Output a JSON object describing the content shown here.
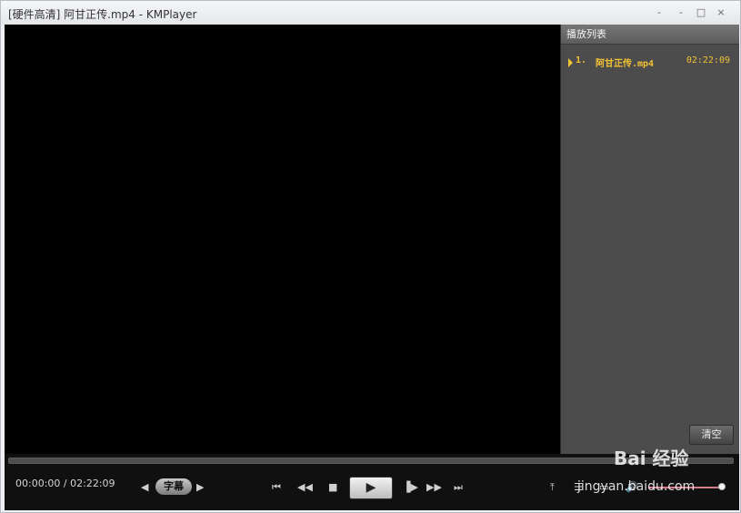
{
  "window": {
    "title": "[硬件高清] 阿甘正传.mp4 - KMPlayer",
    "buttons": [
      "-",
      "-",
      "□",
      "×"
    ]
  },
  "playlist": {
    "title": "播放列表",
    "items": [
      {
        "number": "1.",
        "name": "阿甘正传.mp4",
        "duration": "02:22:09",
        "active": true
      }
    ],
    "clear_label": "清空"
  },
  "player": {
    "time_current": "00:00:00",
    "time_separator": "/",
    "time_total": "02:22:09",
    "subtitle_label": "字幕",
    "seek_progress_percent": 0,
    "volume_percent": 95
  },
  "icons": {
    "subtitle_prev": "triangle-left-icon",
    "subtitle_next": "triangle-right-icon",
    "skip_prev": "skip-previous-icon",
    "rewind": "rewind-icon",
    "stop": "stop-icon",
    "play": "play-icon",
    "step": "step-forward-icon",
    "fast_forward": "fast-forward-icon",
    "skip_next": "skip-next-icon",
    "open": "open-file-icon",
    "playlist": "playlist-icon",
    "settings": "settings-icon",
    "volume": "volume-icon"
  },
  "watermark": {
    "brand": "Bai 经验",
    "url": "jingyan.baidu.com"
  },
  "colors": {
    "accent_yellow": "#f2c233",
    "playlist_bg": "#4c4c4c",
    "video_bg": "#000000",
    "control_bg": "#101010"
  }
}
